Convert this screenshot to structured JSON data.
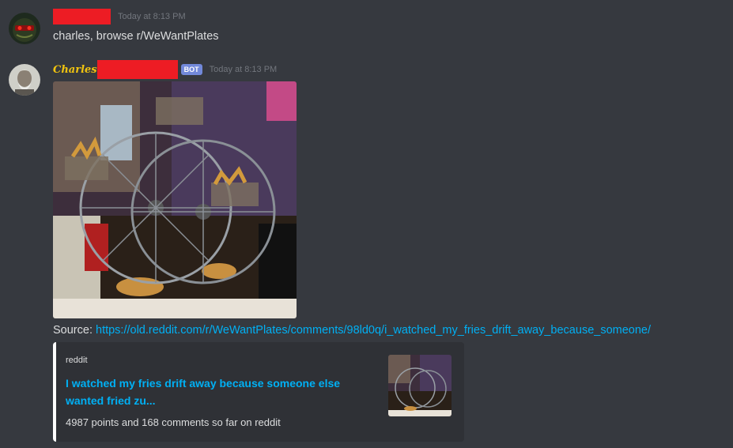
{
  "messages": [
    {
      "author": "",
      "timestamp": "Today at 8:13 PM",
      "text": "charles, browse r/WeWantPlates"
    },
    {
      "author": "Charles",
      "bot_tag": "BOT",
      "timestamp": "Today at 8:13 PM",
      "source_label": "Source: ",
      "source_url": "https://old.reddit.com/r/WeWantPlates/comments/98ld0q/i_watched_my_fries_drift_away_because_someone/",
      "embed": {
        "provider": "reddit",
        "title": "I watched my fries drift away because someone else wanted fried zu...",
        "description": "4987 points and 168 comments so far on reddit"
      }
    }
  ],
  "colors": {
    "background": "#36393f",
    "embed_background": "#2f3136",
    "link": "#00b0f4",
    "timestamp": "#72767d",
    "bot_tag": "#7289da",
    "bot_name": "#f1c40f",
    "redaction": "#ed1c24"
  },
  "icons": {
    "user_avatar": "masked-face-avatar",
    "bot_avatar": "elderly-man-avatar",
    "photo": "ferris-wheel-fries-photo"
  }
}
